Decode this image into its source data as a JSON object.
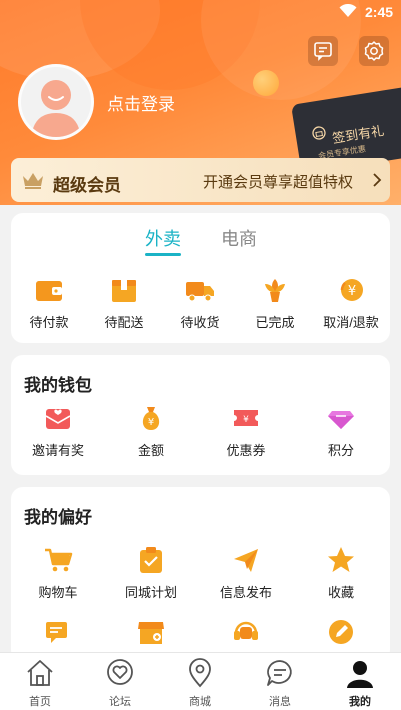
{
  "status_bar": {
    "time": "2:45"
  },
  "header": {
    "login_text": "点击登录",
    "signin": {
      "title": "签到有礼",
      "subtitle": "会员专享优惠"
    }
  },
  "vip": {
    "title": "超级会员",
    "promo": "开通会员尊享超值特权"
  },
  "orders": {
    "tabs": [
      {
        "label": "外卖",
        "active": true
      },
      {
        "label": "电商",
        "active": false
      }
    ],
    "items": [
      {
        "label": "待付款",
        "icon": "wallet-icon"
      },
      {
        "label": "待配送",
        "icon": "package-icon"
      },
      {
        "label": "待收货",
        "icon": "truck-icon"
      },
      {
        "label": "已完成",
        "icon": "flower-icon"
      },
      {
        "label": "取消/退款",
        "icon": "refund-icon"
      }
    ]
  },
  "wallet": {
    "title": "我的钱包",
    "items": [
      {
        "label": "邀请有奖",
        "icon": "gift-mail-icon"
      },
      {
        "label": "金额",
        "icon": "money-bag-icon"
      },
      {
        "label": "优惠券",
        "icon": "coupon-icon"
      },
      {
        "label": "积分",
        "icon": "diamond-icon"
      }
    ]
  },
  "preferences": {
    "title": "我的偏好",
    "items": [
      {
        "label": "购物车",
        "icon": "cart-icon"
      },
      {
        "label": "同城计划",
        "icon": "clipboard-icon"
      },
      {
        "label": "信息发布",
        "icon": "paper-plane-icon"
      },
      {
        "label": "收藏",
        "icon": "star-icon"
      },
      {
        "label": "",
        "icon": "chat-icon"
      },
      {
        "label": "",
        "icon": "store-icon"
      },
      {
        "label": "",
        "icon": "headset-icon"
      },
      {
        "label": "",
        "icon": "pencil-icon"
      }
    ]
  },
  "bottom_nav": [
    {
      "label": "首页",
      "icon": "home-icon",
      "active": false
    },
    {
      "label": "论坛",
      "icon": "heart-bubble-icon",
      "active": false
    },
    {
      "label": "商城",
      "icon": "map-pin-icon",
      "active": false
    },
    {
      "label": "消息",
      "icon": "message-icon",
      "active": false
    },
    {
      "label": "我的",
      "icon": "user-icon",
      "active": true
    }
  ],
  "colors": {
    "accent": "#ff7a2a",
    "tab_active": "#1bb3c6",
    "icon_orange": "#f5a623"
  }
}
